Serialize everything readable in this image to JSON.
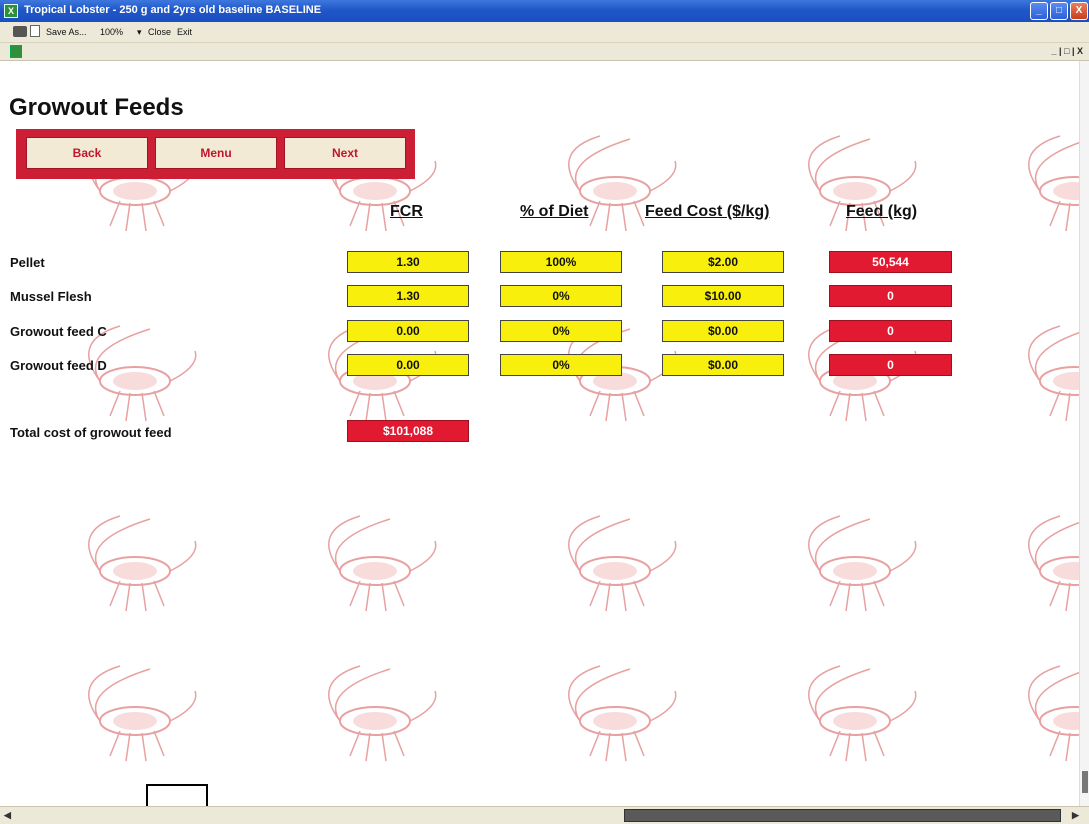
{
  "window": {
    "title": "Tropical Lobster - 250 g and 2yrs old baseline BASELINE",
    "controls": [
      "_",
      "□",
      "X"
    ]
  },
  "toolbar": {
    "save_as": "Save As...",
    "zoom": "100%",
    "close": "Close",
    "exit": "Exit",
    "sheet_controls": "_ | □ | X"
  },
  "page": {
    "heading": "Growout Feeds"
  },
  "nav": {
    "back": "Back",
    "menu": "Menu",
    "next": "Next"
  },
  "columns": [
    "FCR",
    "% of Diet",
    "Feed Cost ($/kg)",
    "Feed (kg)"
  ],
  "rows": [
    {
      "label": "Pellet",
      "fcr": "1.30",
      "diet": "100%",
      "cost": "$2.00",
      "feed": "50,544"
    },
    {
      "label": "Mussel Flesh",
      "fcr": "1.30",
      "diet": "0%",
      "cost": "$10.00",
      "feed": "0"
    },
    {
      "label": "Growout feed C",
      "fcr": "0.00",
      "diet": "0%",
      "cost": "$0.00",
      "feed": "0"
    },
    {
      "label": "Growout feed D",
      "fcr": "0.00",
      "diet": "0%",
      "cost": "$0.00",
      "feed": "0"
    }
  ],
  "total": {
    "label": "Total cost of growout feed",
    "value": "$101,088"
  },
  "colors": {
    "input_cell": "#f8f00c",
    "output_cell": "#e11a32",
    "nav_frame": "#cc1f35",
    "title_bar": "#2057c8"
  }
}
